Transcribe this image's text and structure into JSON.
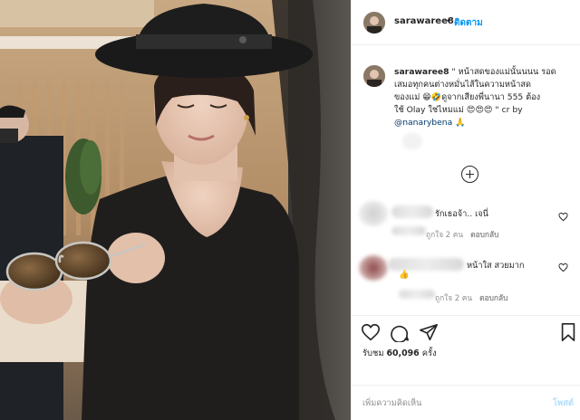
{
  "header": {
    "username": "sarawaree8",
    "separator": "•",
    "follow_label": "ติดตาม",
    "more_icon": "more-icon"
  },
  "caption": {
    "username": "sarawaree8",
    "line1": " \" หน้าสดของแม่นั้นนนน รอด",
    "line2": "เสมอทุกคนต่างหมั่นไส้ในความหน้าสด",
    "line3": "ของแม่ 😁🤣ดูจากเสียงพี่นานา 555 ต้อง",
    "line4": "ใช้ Olay ใช่ไหมแม่ 😍😍😍 \" cr by",
    "mention": "@nanarybena",
    "mention_suffix": " 🙏"
  },
  "load_more_icon": "plus-circle-icon",
  "comments": [
    {
      "text": "รักเธอจ้า.. เจนี่",
      "likes": "ถูกใจ 2 คน",
      "reply": "ตอบกลับ"
    },
    {
      "text": "หน้าใส สวยมาก",
      "text2": "👍",
      "likes": "ถูกใจ 2 คน",
      "reply": "ตอบกลับ"
    }
  ],
  "actions": {
    "like_icon": "heart-icon",
    "comment_icon": "comment-bubble-icon",
    "share_icon": "paper-plane-icon",
    "save_icon": "bookmark-icon"
  },
  "views": {
    "label": "รับชม",
    "count": "60,096",
    "unit": "ครั้ง"
  },
  "comment_box": {
    "placeholder": "เพิ่มความคิดเห็น",
    "post_label": "โพสต์"
  },
  "colors": {
    "link": "#0095f6",
    "mention": "#00376b",
    "muted": "#8e8e8e",
    "post_disabled": "#b2dffc"
  }
}
